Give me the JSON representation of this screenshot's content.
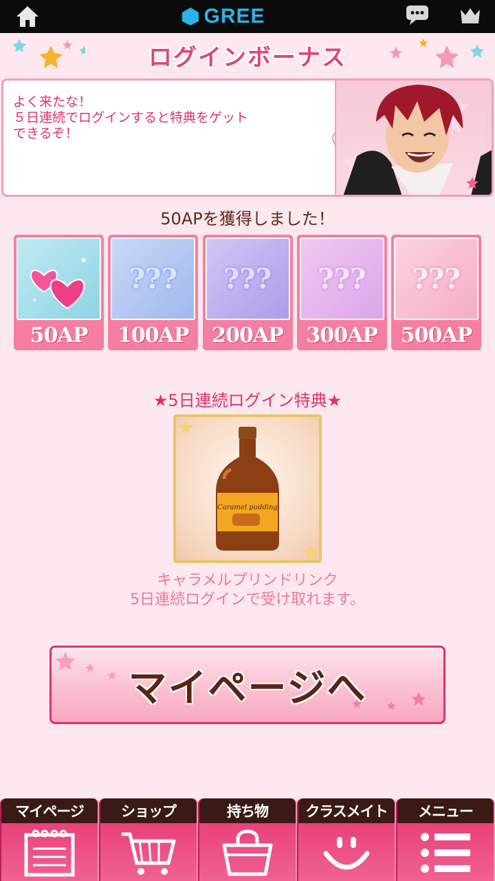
{
  "topbar": {
    "brand": "GREE",
    "icons": [
      "home-icon",
      "gree-hexagon-icon",
      "chat-icon",
      "crown-icon"
    ]
  },
  "title": "ログインボーナス",
  "speech": {
    "lines": [
      "よく来たな！",
      "５日連続でログインすると特典をゲット",
      "できるぞ！"
    ]
  },
  "ap_heading": "50APを獲得しました！",
  "cards": [
    {
      "label": "50AP",
      "content": "hearts",
      "state": "obtained"
    },
    {
      "label": "100AP",
      "content": "???",
      "state": "locked"
    },
    {
      "label": "200AP",
      "content": "???",
      "state": "locked"
    },
    {
      "label": "300AP",
      "content": "???",
      "state": "locked"
    },
    {
      "label": "500AP",
      "content": "???",
      "state": "locked"
    }
  ],
  "reward": {
    "title": "★5日連続ログイン特典★",
    "name": "キャラメルプリンドリンク",
    "description": "5日連続ログインで受け取れます。",
    "bottle_label": "Caramel pudding"
  },
  "mypage_button": "マイページへ",
  "bottom_nav": [
    {
      "label": "マイページ",
      "icon": "notebook-icon"
    },
    {
      "label": "ショップ",
      "icon": "cart-icon"
    },
    {
      "label": "持ち物",
      "icon": "bag-icon"
    },
    {
      "label": "クラスメイト",
      "icon": "smiley-icon"
    },
    {
      "label": "メニュー",
      "icon": "list-icon"
    }
  ],
  "colors": {
    "accent": "#e0306e",
    "background": "#fde8ef",
    "brand": "#2bb3e6"
  }
}
